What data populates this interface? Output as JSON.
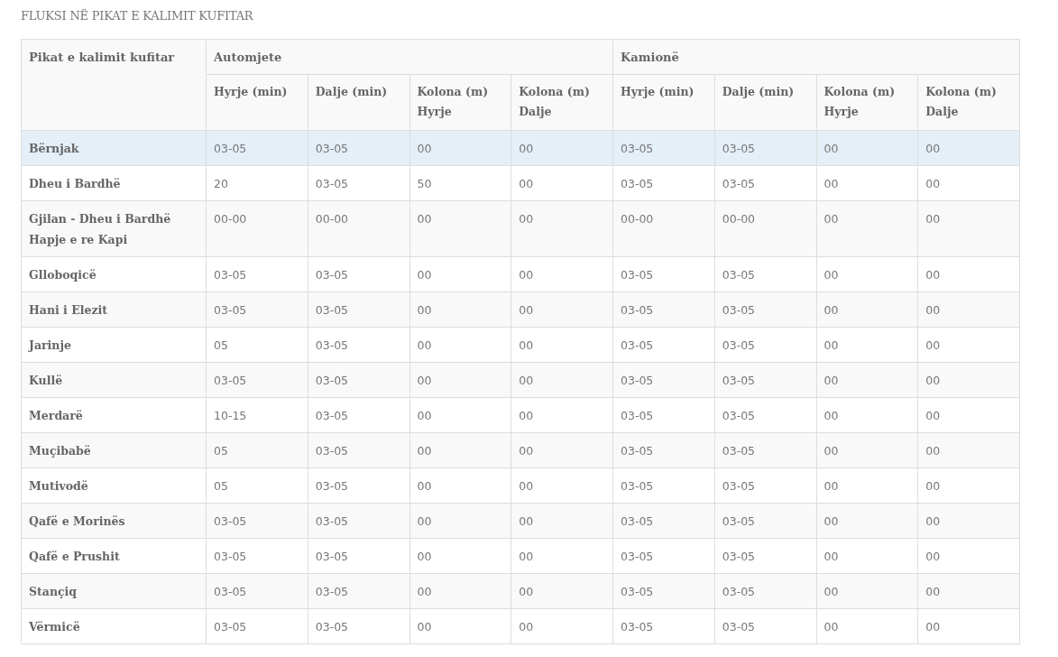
{
  "title": "FLUKSI NË PIKAT E KALIMIT KUFITAR",
  "table": {
    "corner_header": "Pikat e kalimit kufitar",
    "groups": [
      {
        "label": "Automjete",
        "columns": [
          "Hyrje (min)",
          "Dalje (min)",
          "Kolona (m) Hyrje",
          "Kolona (m) Dalje"
        ]
      },
      {
        "label": "Kamionë",
        "columns": [
          "Hyrje (min)",
          "Dalje (min)",
          "Kolona (m) Hyrje",
          "Kolona (m) Dalje"
        ]
      }
    ],
    "rows": [
      {
        "name": "Bërnjak",
        "selected": true,
        "cells": [
          "03-05",
          "03-05",
          "00",
          "00",
          "03-05",
          "03-05",
          "00",
          "00"
        ]
      },
      {
        "name": "Dheu i Bardhë",
        "selected": false,
        "cells": [
          "20",
          "03-05",
          "50",
          "00",
          "03-05",
          "03-05",
          "00",
          "00"
        ]
      },
      {
        "name": "Gjilan - Dheu i Bardhë Hapje e re Kapi",
        "selected": false,
        "cells": [
          "00-00",
          "00-00",
          "00",
          "00",
          "00-00",
          "00-00",
          "00",
          "00"
        ]
      },
      {
        "name": "Glloboqicë",
        "selected": false,
        "cells": [
          "03-05",
          "03-05",
          "00",
          "00",
          "03-05",
          "03-05",
          "00",
          "00"
        ]
      },
      {
        "name": "Hani i Elezit",
        "selected": false,
        "cells": [
          "03-05",
          "03-05",
          "00",
          "00",
          "03-05",
          "03-05",
          "00",
          "00"
        ]
      },
      {
        "name": "Jarinje",
        "selected": false,
        "cells": [
          "05",
          "03-05",
          "00",
          "00",
          "03-05",
          "03-05",
          "00",
          "00"
        ]
      },
      {
        "name": "Kullë",
        "selected": false,
        "cells": [
          "03-05",
          "03-05",
          "00",
          "00",
          "03-05",
          "03-05",
          "00",
          "00"
        ]
      },
      {
        "name": "Merdarë",
        "selected": false,
        "cells": [
          "10-15",
          "03-05",
          "00",
          "00",
          "03-05",
          "03-05",
          "00",
          "00"
        ]
      },
      {
        "name": "Muçibabë",
        "selected": false,
        "cells": [
          "05",
          "03-05",
          "00",
          "00",
          "03-05",
          "03-05",
          "00",
          "00"
        ]
      },
      {
        "name": "Mutivodë",
        "selected": false,
        "cells": [
          "05",
          "03-05",
          "00",
          "00",
          "03-05",
          "03-05",
          "00",
          "00"
        ]
      },
      {
        "name": "Qafë e Morinës",
        "selected": false,
        "cells": [
          "03-05",
          "03-05",
          "00",
          "00",
          "03-05",
          "03-05",
          "00",
          "00"
        ]
      },
      {
        "name": "Qafë e Prushit",
        "selected": false,
        "cells": [
          "03-05",
          "03-05",
          "00",
          "00",
          "03-05",
          "03-05",
          "00",
          "00"
        ]
      },
      {
        "name": "Stançiq",
        "selected": false,
        "cells": [
          "03-05",
          "03-05",
          "00",
          "00",
          "03-05",
          "03-05",
          "00",
          "00"
        ]
      },
      {
        "name": "Vërmicë",
        "selected": false,
        "cells": [
          "03-05",
          "03-05",
          "00",
          "00",
          "03-05",
          "03-05",
          "00",
          "00"
        ]
      }
    ]
  }
}
